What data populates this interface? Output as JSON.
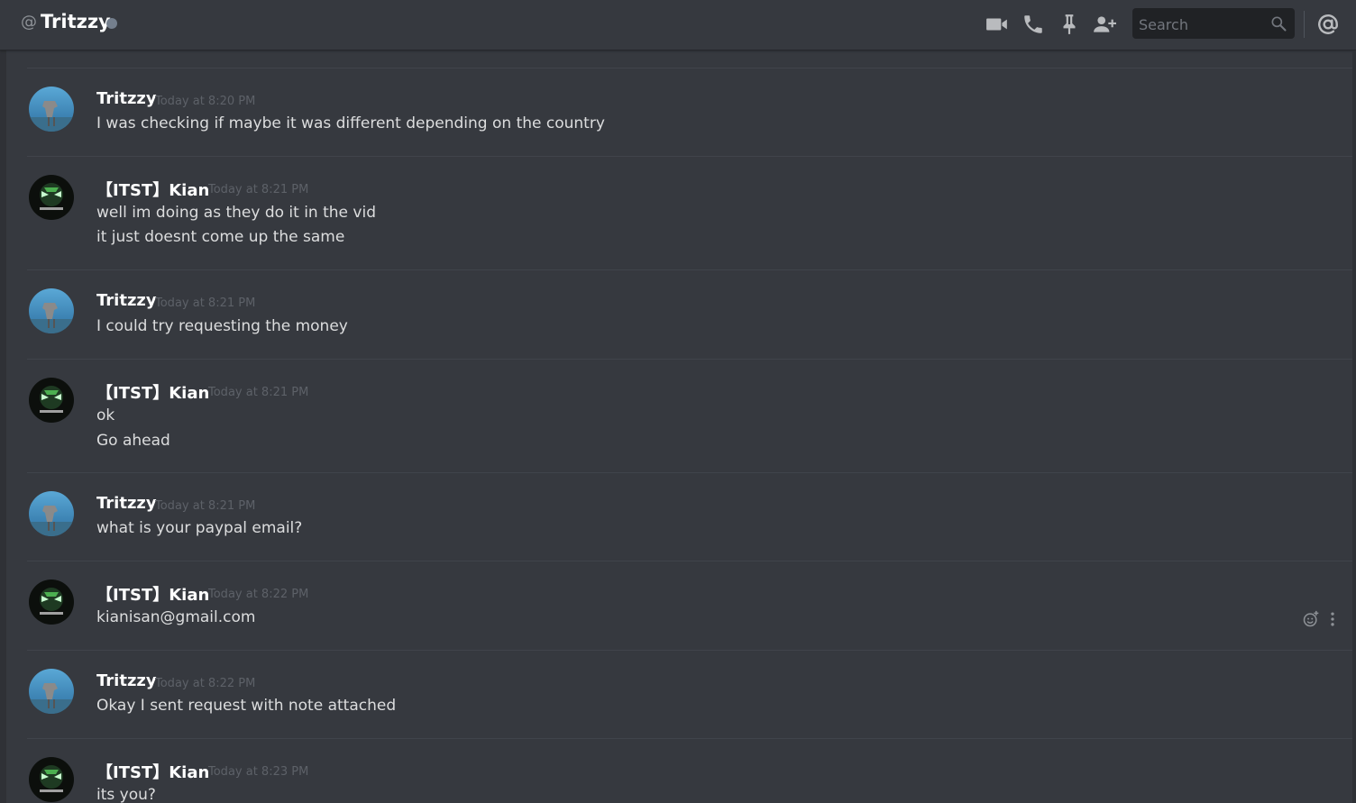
{
  "header": {
    "at_symbol": "@",
    "title": "Tritzzy",
    "search_placeholder": "Search",
    "status_color": "#747f8d"
  },
  "icons": [
    "video-call-icon",
    "voice-call-icon",
    "pin-icon",
    "add-friend-icon",
    "search-icon",
    "mention-icon"
  ],
  "messages": [
    {
      "author": "Tritzzy",
      "timestamp": "Today at 8:20 PM",
      "lines": [
        "I was checking if maybe it was different depending on the country"
      ]
    },
    {
      "author": "【ITST】Kian",
      "timestamp": "Today at 8:21 PM",
      "lines": [
        "well im doing as they do it in the vid",
        "it just doesnt come up the same"
      ]
    },
    {
      "author": "Tritzzy",
      "timestamp": "Today at 8:21 PM",
      "lines": [
        "I could try requesting the money"
      ]
    },
    {
      "author": "【ITST】Kian",
      "timestamp": "Today at 8:21 PM",
      "lines": [
        "ok",
        "Go ahead"
      ]
    },
    {
      "author": "Tritzzy",
      "timestamp": "Today at 8:21 PM",
      "lines": [
        "what is your paypal email?"
      ]
    },
    {
      "author": "【ITST】Kian",
      "timestamp": "Today at 8:22 PM",
      "lines": [
        "kianisan@gmail.com"
      ]
    },
    {
      "author": "Tritzzy",
      "timestamp": "Today at 8:22 PM",
      "lines": [
        "Okay I sent request with note attached"
      ]
    },
    {
      "author": "【ITST】Kian",
      "timestamp": "Today at 8:23 PM",
      "lines": [
        "its you?"
      ]
    }
  ],
  "colors": {
    "background": "#36393f",
    "header_background": "#36393f",
    "username": "#ffffff",
    "timestamp": "#5d6168",
    "message_text": "#dcddde",
    "divider": "#40444b"
  }
}
